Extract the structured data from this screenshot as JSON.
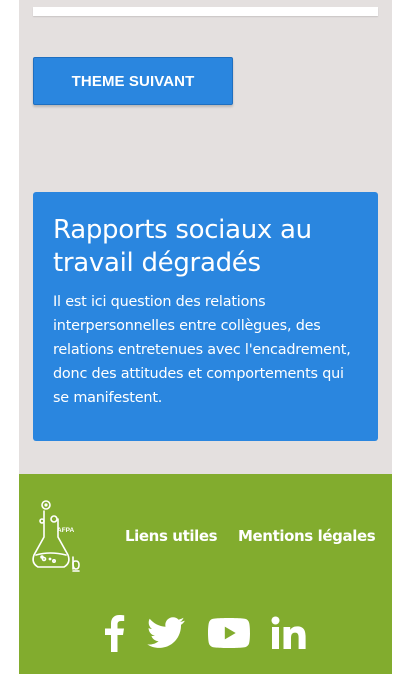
{
  "navigation": {
    "next_theme_label": "THEME SUIVANT"
  },
  "card": {
    "title": "Rapports sociaux au travail dégradés",
    "description": "Il est ici question des relations interpersonnelles entre collègues, des relations entretenues avec l'encadrement, donc des attitudes et comportements qui se manifestent."
  },
  "footer": {
    "logo_text": "AFPA",
    "logo_subtext": "lab",
    "links": [
      {
        "label": "Liens utiles"
      },
      {
        "label": "Mentions légales"
      }
    ],
    "social": [
      {
        "icon": "facebook-icon"
      },
      {
        "icon": "twitter-icon"
      },
      {
        "icon": "youtube-icon"
      },
      {
        "icon": "linkedin-icon"
      }
    ]
  },
  "colors": {
    "page_background": "#e4e0df",
    "accent_blue": "#2a86df",
    "footer_green": "#82ac2e",
    "text_white": "#ffffff"
  }
}
